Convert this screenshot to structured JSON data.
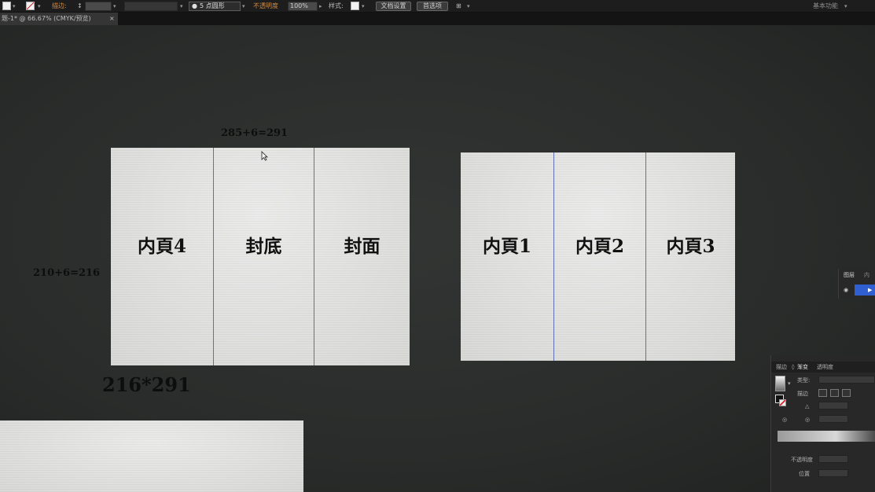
{
  "toolbar": {
    "stroke_label": "描边:",
    "brush_label": "5 点圆形",
    "opacity_label": "不透明度",
    "opacity_value": "100%",
    "style_label": "样式:",
    "document_setup_label": "文档设置",
    "preferences_label": "首选项",
    "workspace_label": "基本功能"
  },
  "document_tab": {
    "title": "题-1* @ 66.67% (CMYK/预览)",
    "close": "×"
  },
  "canvas": {
    "width_formula": "285+6=291",
    "height_formula": "210+6=216",
    "size_label": "216*291",
    "artboards": [
      {
        "panels": [
          "内頁4",
          "封底",
          "封面"
        ]
      },
      {
        "panels": [
          "内頁1",
          "内頁2",
          "内頁3"
        ]
      }
    ]
  },
  "layers_panel": {
    "tabs": [
      "图层",
      "内"
    ]
  },
  "gradient_panel": {
    "tabs": [
      "描边",
      "渐变",
      "透明度"
    ],
    "type_label": "类型:",
    "stroke_label": "描边",
    "opacity_label": "不透明度",
    "location_label": "位置"
  },
  "colors": {
    "accent": "#d98a3a",
    "canvas": "#2b2d2c",
    "artboard": "#e4e5e3",
    "divider": "#6070b0",
    "selection": "#2f5fd0"
  }
}
